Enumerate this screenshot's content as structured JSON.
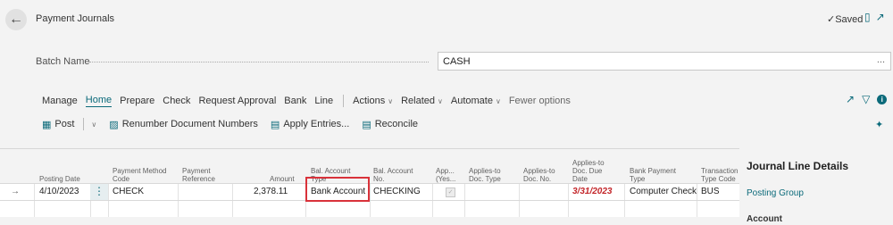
{
  "header": {
    "title": "Payment Journals",
    "saved_label": "Saved"
  },
  "batch": {
    "label": "Batch Name",
    "value": "CASH",
    "ellipsis": "..."
  },
  "menu": {
    "items": [
      "Manage",
      "Home",
      "Prepare",
      "Check",
      "Request Approval",
      "Bank",
      "Line"
    ],
    "dropdowns": [
      "Actions",
      "Related",
      "Automate"
    ],
    "fewer_options": "Fewer options",
    "active": "Home"
  },
  "actions": {
    "post": "Post",
    "renumber": "Renumber Document Numbers",
    "apply_entries": "Apply Entries...",
    "reconcile": "Reconcile"
  },
  "grid": {
    "columns": {
      "posting_date": "Posting Date",
      "payment_method_code_1": "Payment Method",
      "payment_method_code_2": "Code",
      "payment_reference_1": "Payment",
      "payment_reference_2": "Reference",
      "amount": "Amount",
      "bal_account_type_1": "Bal. Account",
      "bal_account_type_2": "Type",
      "bal_account_no_1": "Bal. Account",
      "bal_account_no_2": "No.",
      "approved_1": "App...",
      "approved_2": "(Yes...",
      "applies_to_doc_type_1": "Applies-to",
      "applies_to_doc_type_2": "Doc. Type",
      "applies_to_doc_no_1": "Applies-to",
      "applies_to_doc_no_2": "Doc. No.",
      "applies_to_due_1": "Applies-to",
      "applies_to_due_2": "Doc. Due",
      "applies_to_due_3": "Date",
      "bank_payment_type_1": "Bank Payment",
      "bank_payment_type_2": "Type",
      "transaction_type_1": "Transaction",
      "transaction_type_2": "Type Code"
    },
    "rows": [
      {
        "posting_date": "4/10/2023",
        "payment_method_code": "CHECK",
        "payment_reference": "",
        "amount": "2,378.11",
        "bal_account_type": "Bank Account",
        "bal_account_no": "CHECKING",
        "applies_to_doc_type": "",
        "applies_to_doc_no": "",
        "applies_to_due_date": "3/31/2023",
        "bank_payment_type": "Computer Check",
        "transaction_type_code": "BUS"
      }
    ]
  },
  "details": {
    "title": "Journal Line Details",
    "posting_group": "Posting Group",
    "account": "Account"
  },
  "colors": {
    "accent": "#0b6a7a",
    "highlight_border": "#d9323a",
    "due_date": "#c3262a"
  }
}
